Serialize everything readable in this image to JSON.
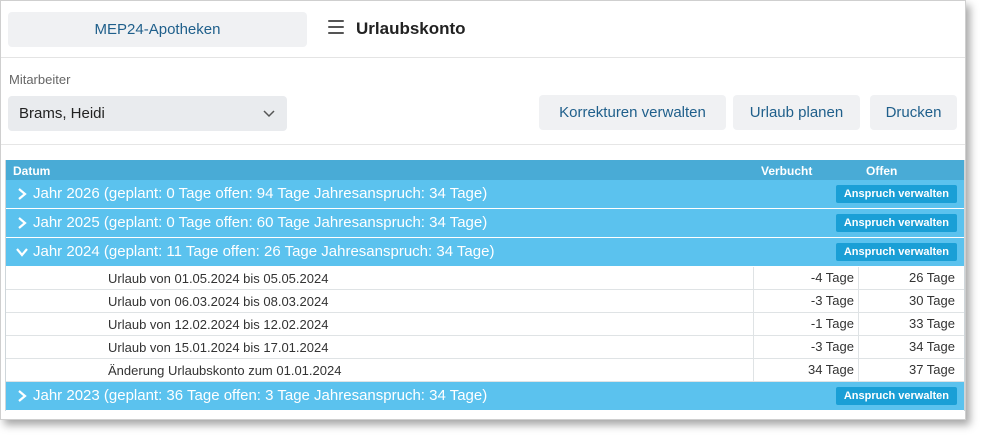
{
  "app": {
    "brand": "MEP24-Apotheken",
    "page_title": "Urlaubskonto"
  },
  "employee": {
    "label": "Mitarbeiter",
    "selected": "Brams, Heidi"
  },
  "actions": {
    "korrekturen": "Korrekturen verwalten",
    "urlaub_planen": "Urlaub planen",
    "drucken": "Drucken"
  },
  "table": {
    "headers": {
      "datum": "Datum",
      "verbucht": "Verbucht",
      "offen": "Offen"
    },
    "years": [
      {
        "label": "Jahr 2026 (geplant: 0 Tage offen: 94 Tage Jahresanspruch: 34 Tage)",
        "button": "Anspruch verwalten",
        "expanded": false
      },
      {
        "label": "Jahr 2025 (geplant: 0 Tage offen: 60 Tage Jahresanspruch: 34 Tage)",
        "button": "Anspruch verwalten",
        "expanded": false
      },
      {
        "label": "Jahr 2024 (geplant: 11 Tage offen: 26 Tage Jahresanspruch: 34 Tage)",
        "button": "Anspruch verwalten",
        "expanded": true
      },
      {
        "label": "Jahr 2023 (geplant: 36 Tage offen: 3 Tage Jahresanspruch: 34 Tage)",
        "button": "Anspruch verwalten",
        "expanded": false
      }
    ],
    "rows_2024": [
      {
        "label": "Urlaub von 01.05.2024 bis 05.05.2024",
        "verbucht": "-4 Tage",
        "offen": "26 Tage"
      },
      {
        "label": "Urlaub von 06.03.2024 bis 08.03.2024",
        "verbucht": "-3 Tage",
        "offen": "30 Tage"
      },
      {
        "label": "Urlaub von 12.02.2024 bis 12.02.2024",
        "verbucht": "-1 Tage",
        "offen": "33 Tage"
      },
      {
        "label": "Urlaub von 15.01.2024 bis 17.01.2024",
        "verbucht": "-3 Tage",
        "offen": "34 Tage"
      },
      {
        "label": "Änderung Urlaubskonto zum 01.01.2024",
        "verbucht": "34 Tage",
        "offen": "37 Tage"
      }
    ]
  },
  "colors": {
    "header": "#49abd6",
    "year_row": "#5bc2ee",
    "year_button": "#1a9fd6",
    "brand_text": "#1f5f8b"
  },
  "icons": {
    "menu": "hamburger-icon",
    "select": "chevron-down-icon",
    "collapsed": "chevron-right-icon",
    "expanded": "chevron-down-icon"
  }
}
